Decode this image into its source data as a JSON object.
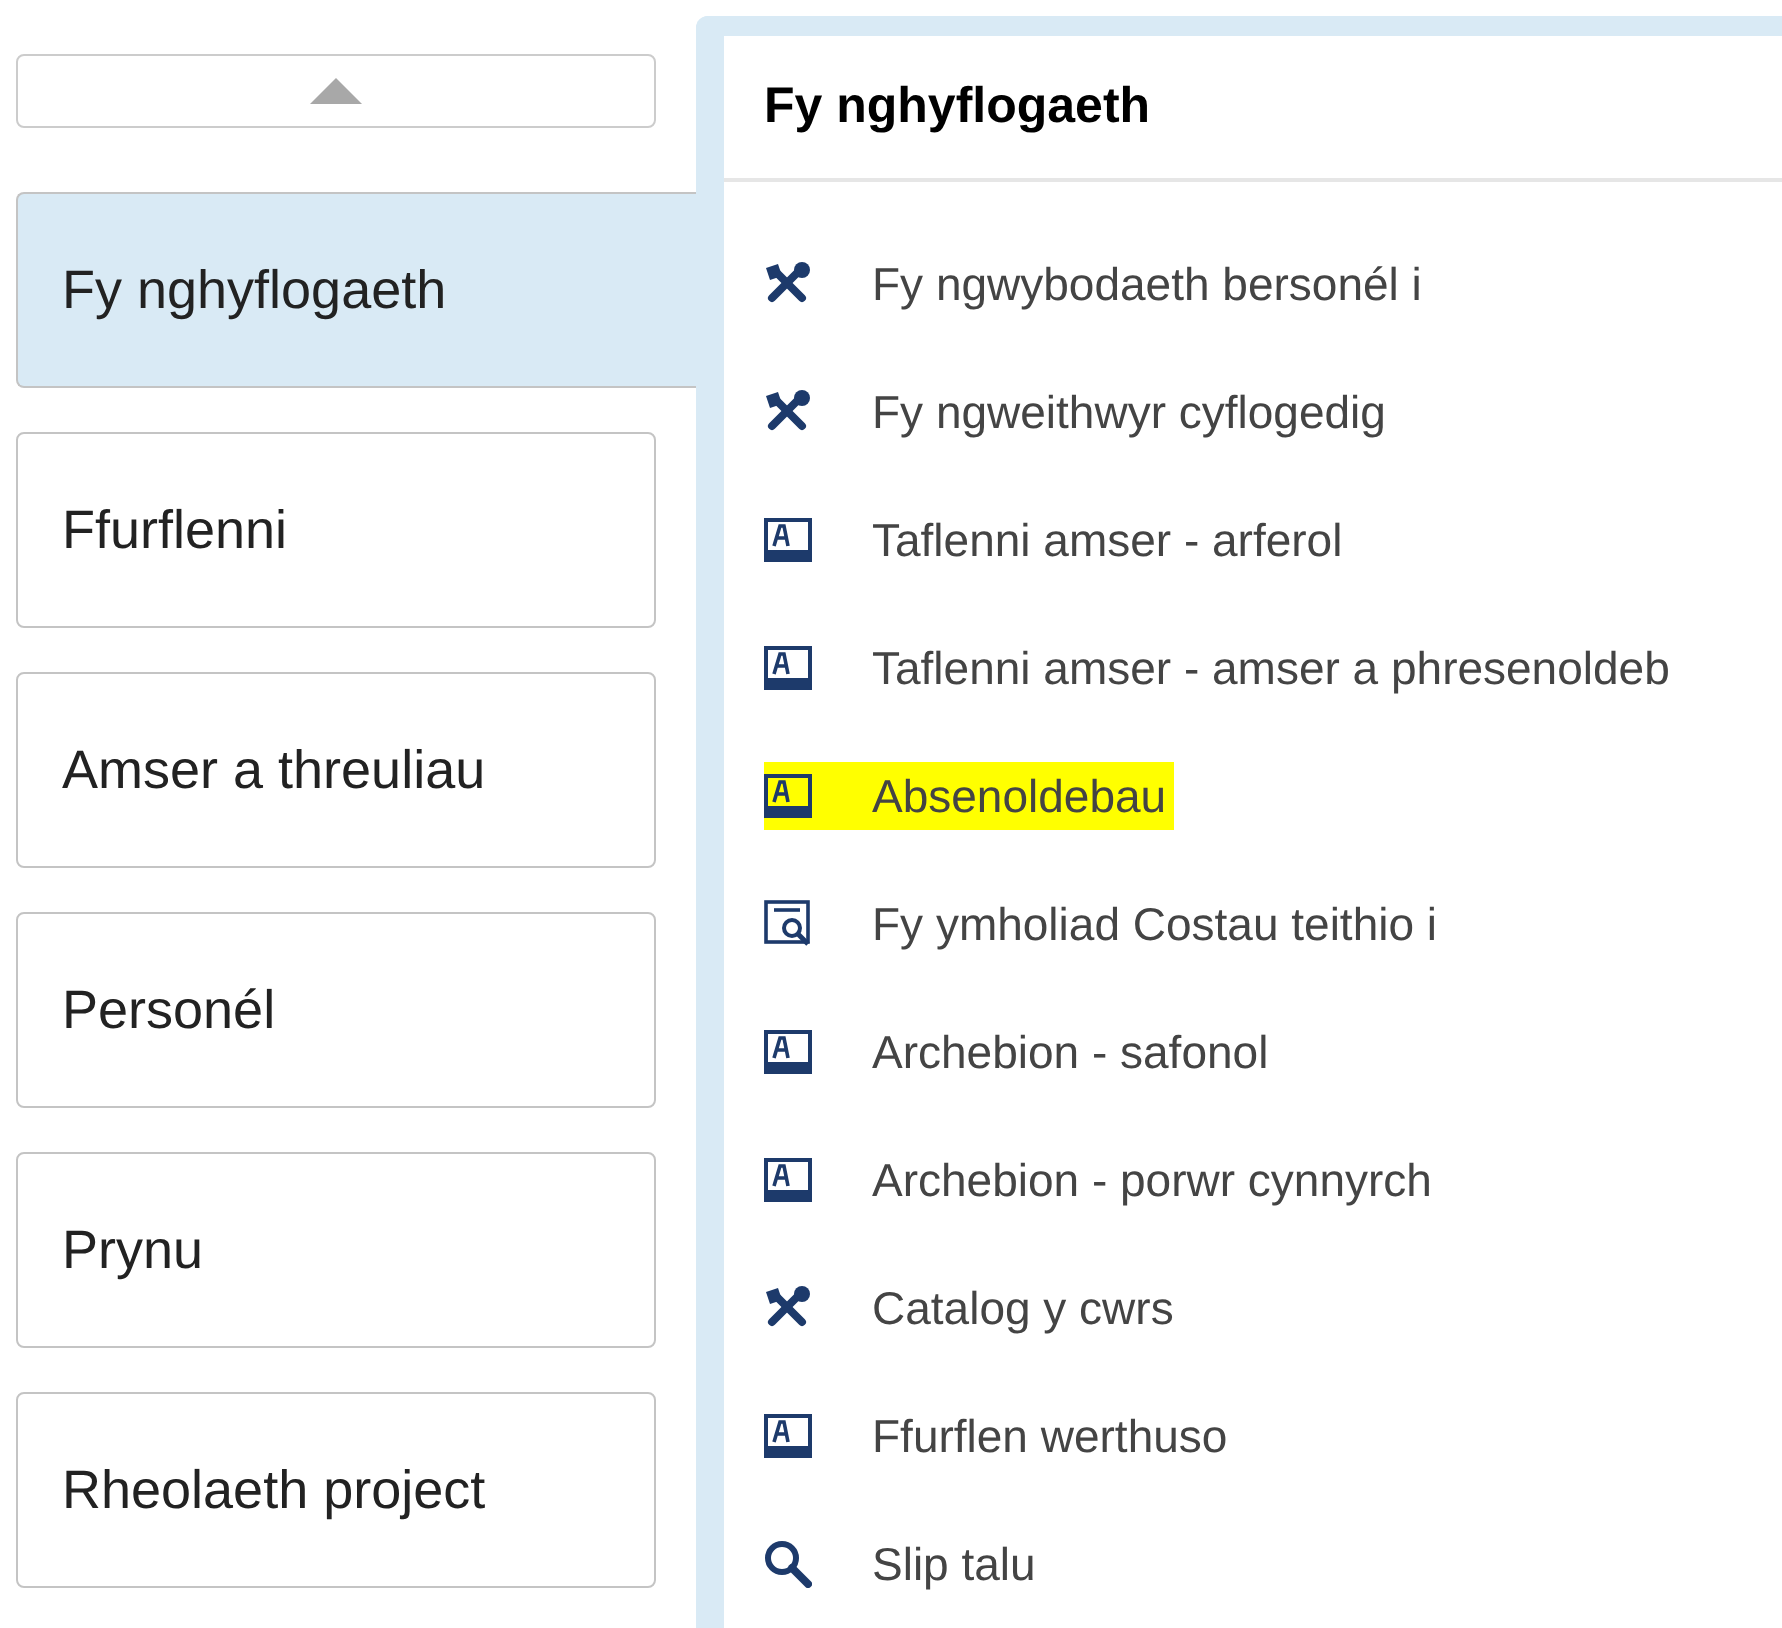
{
  "categories": [
    {
      "label": "Fy nghyflogaeth",
      "selected": true
    },
    {
      "label": "Ffurflenni",
      "selected": false
    },
    {
      "label": "Amser a threuliau",
      "selected": false
    },
    {
      "label": "Personél",
      "selected": false
    },
    {
      "label": "Prynu",
      "selected": false
    },
    {
      "label": "Rheolaeth project",
      "selected": false
    }
  ],
  "panel": {
    "title": "Fy nghyflogaeth",
    "items": [
      {
        "kind": "tools",
        "label": "Fy ngwybodaeth bersonél i",
        "highlighted": false
      },
      {
        "kind": "tools",
        "label": "Fy ngweithwyr cyflogedig",
        "highlighted": false
      },
      {
        "kind": "form",
        "label": "Taflenni amser - arferol",
        "highlighted": false
      },
      {
        "kind": "form",
        "label": "Taflenni amser - amser a phresenoldeb",
        "highlighted": false
      },
      {
        "kind": "form",
        "label": "Absenoldebau",
        "highlighted": true
      },
      {
        "kind": "query",
        "label": "Fy ymholiad Costau teithio i",
        "highlighted": false
      },
      {
        "kind": "form",
        "label": "Archebion - safonol",
        "highlighted": false
      },
      {
        "kind": "form",
        "label": "Archebion - porwr cynnyrch",
        "highlighted": false
      },
      {
        "kind": "tools",
        "label": "Catalog y cwrs",
        "highlighted": false
      },
      {
        "kind": "form",
        "label": "Ffurflen werthuso",
        "highlighted": false
      },
      {
        "kind": "search",
        "label": "Slip talu",
        "highlighted": false
      }
    ]
  }
}
